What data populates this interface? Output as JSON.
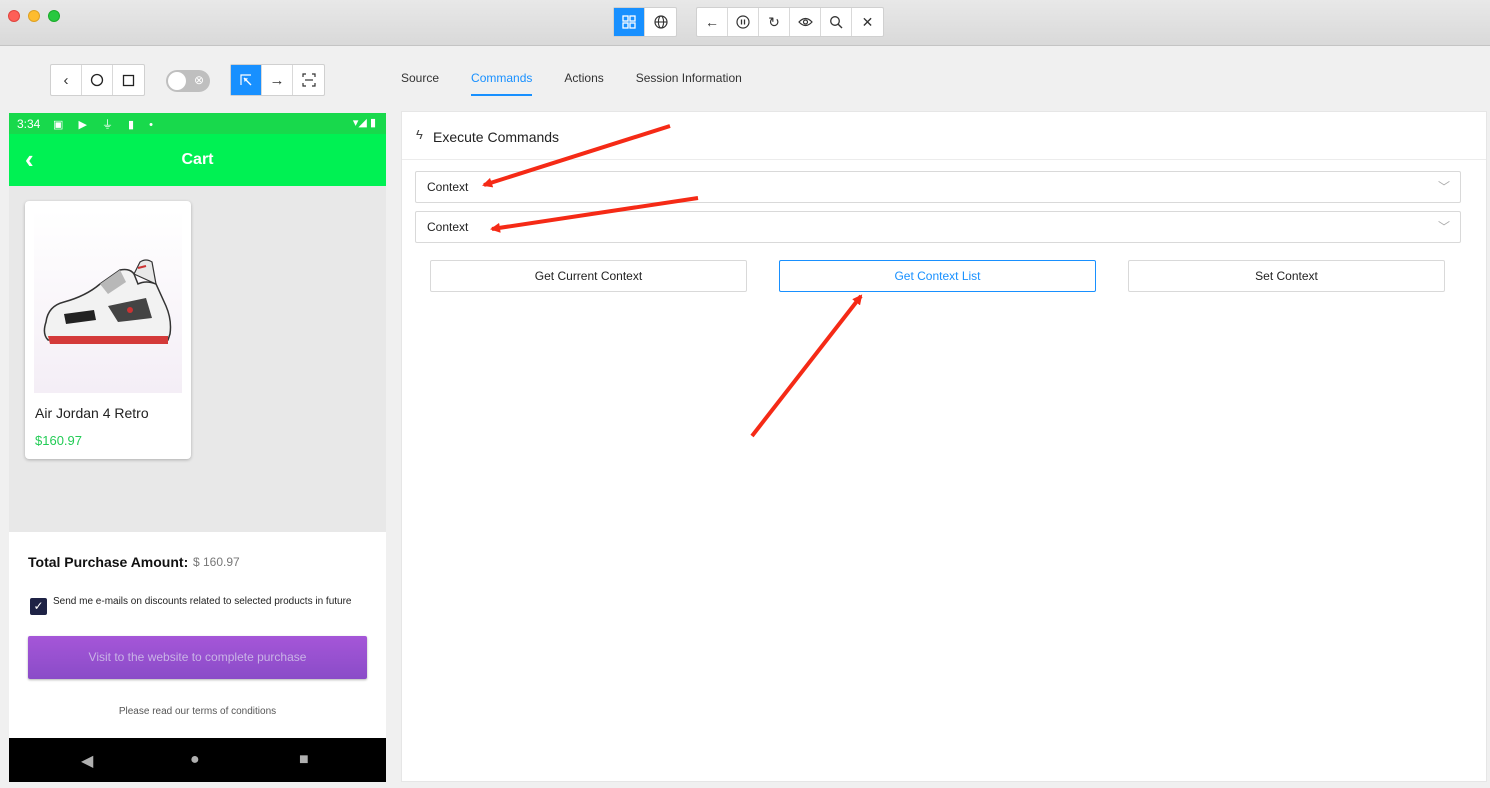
{
  "titlebar": {
    "mode_buttons": [
      "grid-icon",
      "globe-icon"
    ],
    "action_buttons": [
      "back-arrow-icon",
      "pause-icon",
      "refresh-icon",
      "eye-icon",
      "search-icon",
      "close-icon"
    ]
  },
  "device_controls": [
    "back-icon",
    "home-icon",
    "square-icon"
  ],
  "inspect_controls": [
    "select-icon",
    "swipe-icon",
    "frame-icon"
  ],
  "tabs": [
    {
      "label": "Source"
    },
    {
      "label": "Commands",
      "active": true
    },
    {
      "label": "Actions"
    },
    {
      "label": "Session Information"
    }
  ],
  "phone": {
    "status": {
      "time": "3:34"
    },
    "appbar": {
      "title": "Cart"
    },
    "product": {
      "name": "Air Jordan 4 Retro",
      "price": "$160.97"
    },
    "total_label": "Total Purchase Amount:",
    "total_value": "$ 160.97",
    "checkbox_text": "Send me e-mails on discounts related to selected products in future",
    "cta": "Visit to the website to complete purchase",
    "terms": "Please read our terms of conditions"
  },
  "commands": {
    "title": "Execute Commands",
    "select1": "Context",
    "select2": "Context",
    "buttons": [
      "Get Current Context",
      "Get Context List",
      "Set Context"
    ]
  },
  "colors": {
    "accent": "#1890ff",
    "phone_green": "#00f153",
    "arrow": "#f52a16"
  }
}
